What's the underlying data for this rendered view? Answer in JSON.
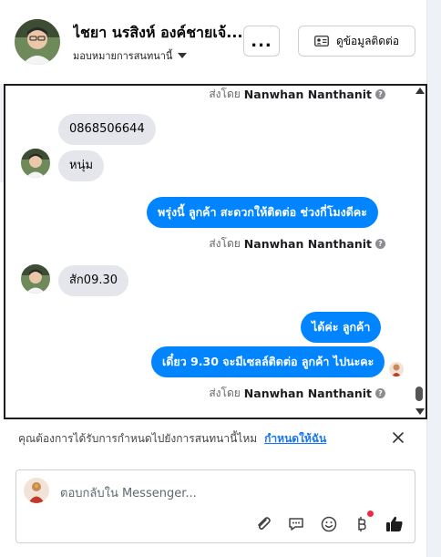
{
  "header": {
    "contact_name": "ไชยา นรสิงห์ องค์ชายเจ้...",
    "assign_label": "มอบหมายการสนทนานี้",
    "more_label": "...",
    "contact_info_label": "ดูข้อมูลติดต่อ"
  },
  "chat": {
    "sent_by_prefix": "ส่งโดย",
    "agent_name": "Nanwhan Nanthanit",
    "info_glyph": "?",
    "messages": [
      {
        "side": "in",
        "text": "0868506644"
      },
      {
        "side": "in",
        "text": "หนุ่ม"
      },
      {
        "side": "out",
        "text": "พรุ่งนี้ ลูกค้า สะดวกให้ติดต่อ ช่วงกี่โมงดีคะ"
      },
      {
        "side": "in",
        "text": "สัก09.30"
      },
      {
        "side": "out",
        "text": "ได้ค่ะ  ลูกค้า"
      },
      {
        "side": "out",
        "text": "เดี๋ยว 9.30 จะมีเซลล์ติดต่อ ลูกค้า ไปนะคะ"
      }
    ]
  },
  "assign_prompt": {
    "text": "คุณต้องการได้รับการกำหนดไปยังการสนทนานี้ไหม",
    "link_label": "กำหนดให้ฉัน"
  },
  "composer": {
    "placeholder": "ตอบกลับใน Messenger..."
  },
  "colors": {
    "outgoing_bubble": "#0084ff",
    "incoming_bubble": "#e4e6eb",
    "link": "#1877f2",
    "notification_dot": "#f02849"
  },
  "icons": [
    "more-icon",
    "contact-card-icon",
    "info-icon",
    "close-icon",
    "attach-icon",
    "chat-bubble-icon",
    "emoji-icon",
    "baht-icon",
    "thumbs-up-icon"
  ]
}
